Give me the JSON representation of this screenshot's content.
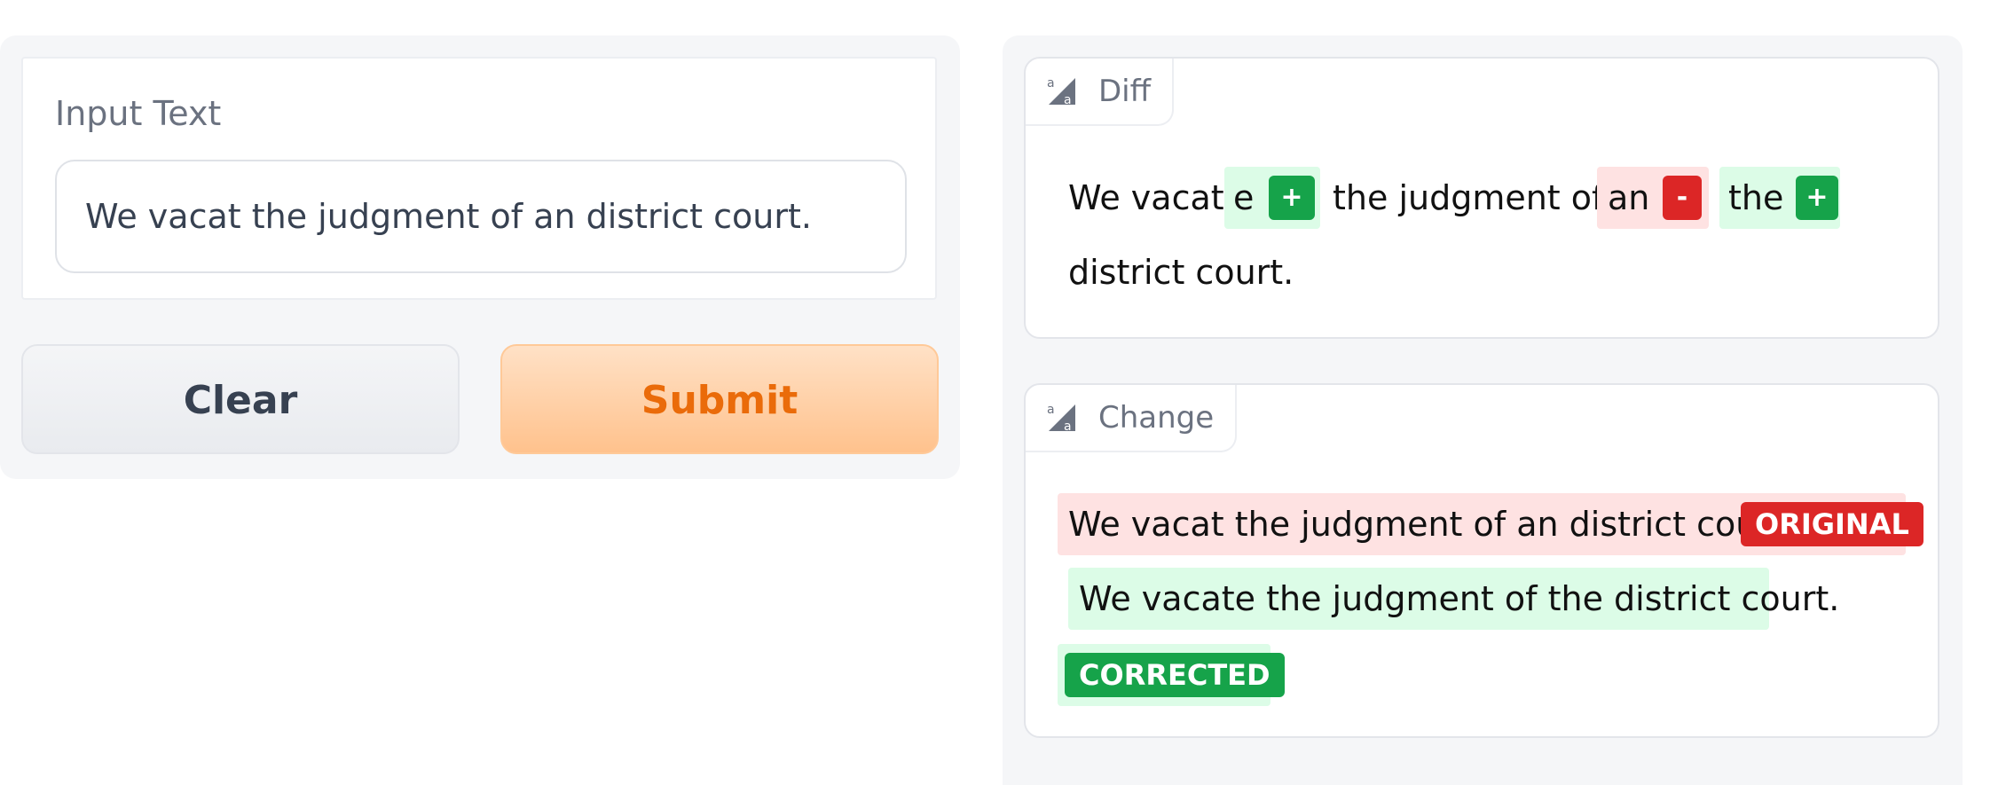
{
  "input": {
    "label": "Input Text",
    "value": "We vacat the judgment of an district court."
  },
  "buttons": {
    "clear_label": "Clear",
    "submit_label": "Submit"
  },
  "diff": {
    "tab_label": "Diff",
    "tokens": [
      {
        "text": "We vacat",
        "type": "equal"
      },
      {
        "text": "e",
        "type": "add",
        "badge": "+"
      },
      {
        "text": "the judgment of",
        "type": "equal"
      },
      {
        "text": "an",
        "type": "delete",
        "badge": "-"
      },
      {
        "text": "the",
        "type": "add",
        "badge": "+"
      },
      {
        "text": "district court.",
        "type": "equal"
      }
    ]
  },
  "change": {
    "tab_label": "Change",
    "original_text": "We vacat the judgment of an district court.",
    "original_badge": "ORIGINAL",
    "corrected_text": "We vacate the judgment of the district court.",
    "corrected_badge": "CORRECTED"
  },
  "colors": {
    "add_bg": "#dcfce7",
    "add_badge": "#16a34a",
    "delete_bg": "#fee2e2",
    "delete_badge": "#dc2626",
    "submit_text": "#ea6b0a"
  },
  "icons": {
    "tab_icon": "text-highlight-icon"
  }
}
